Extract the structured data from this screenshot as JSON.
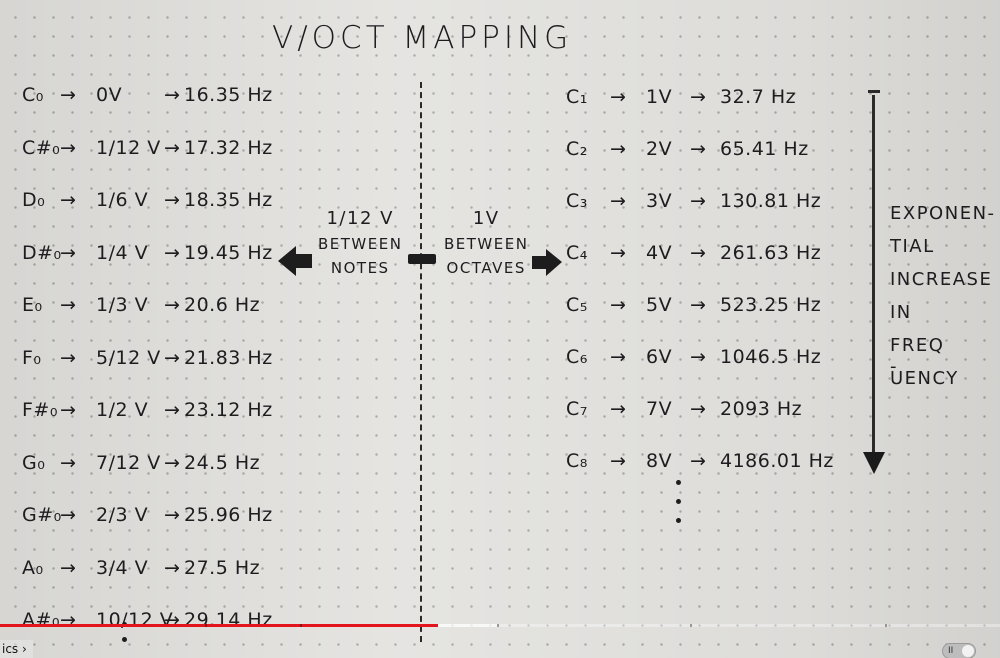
{
  "title": "V/OCT MAPPING",
  "left_rows": [
    {
      "note": "C₀",
      "volt": "0V",
      "freq": "16.35 Hz"
    },
    {
      "note": "C#₀",
      "volt": "1/12 V",
      "freq": "17.32 Hz"
    },
    {
      "note": "D₀",
      "volt": "1/6 V",
      "freq": "18.35 Hz"
    },
    {
      "note": "D#₀",
      "volt": "1/4 V",
      "freq": "19.45 Hz"
    },
    {
      "note": "E₀",
      "volt": "1/3 V",
      "freq": "20.6 Hz"
    },
    {
      "note": "F₀",
      "volt": "5/12 V",
      "freq": "21.83 Hz"
    },
    {
      "note": "F#₀",
      "volt": "1/2 V",
      "freq": "23.12 Hz"
    },
    {
      "note": "G₀",
      "volt": "7/12 V",
      "freq": "24.5 Hz"
    },
    {
      "note": "G#₀",
      "volt": "2/3 V",
      "freq": "25.96 Hz"
    },
    {
      "note": "A₀",
      "volt": "3/4 V",
      "freq": "27.5 Hz"
    },
    {
      "note": "A#₀",
      "volt": "10/12 V",
      "freq": "29.14 Hz"
    }
  ],
  "right_rows": [
    {
      "note": "C₁",
      "volt": "1V",
      "freq": "32.7 Hz"
    },
    {
      "note": "C₂",
      "volt": "2V",
      "freq": "65.41 Hz"
    },
    {
      "note": "C₃",
      "volt": "3V",
      "freq": "130.81 Hz"
    },
    {
      "note": "C₄",
      "volt": "4V",
      "freq": "261.63 Hz"
    },
    {
      "note": "C₅",
      "volt": "5V",
      "freq": "523.25 Hz"
    },
    {
      "note": "C₆",
      "volt": "6V",
      "freq": "1046.5 Hz"
    },
    {
      "note": "C₇",
      "volt": "7V",
      "freq": "2093 Hz"
    },
    {
      "note": "C₈",
      "volt": "8V",
      "freq": "4186.01 Hz"
    }
  ],
  "middle": {
    "left_amount": "1/12 V",
    "left_line1": "BETWEEN",
    "left_line2": "NOTES",
    "right_amount": "1V",
    "right_line1": "BETWEEN",
    "right_line2": "OCTAVES"
  },
  "side_note": [
    "EXPONEN-",
    "TIAL",
    "INCREASE",
    "IN",
    "FREQ -",
    "UENCY"
  ],
  "arrow": "→",
  "player": {
    "chapter_label": "ics",
    "chapter_chevron": "›",
    "played_fraction": 0.438,
    "buffered_fraction": 0.497,
    "toggle_icon": "II",
    "accent": "#e3141b"
  }
}
